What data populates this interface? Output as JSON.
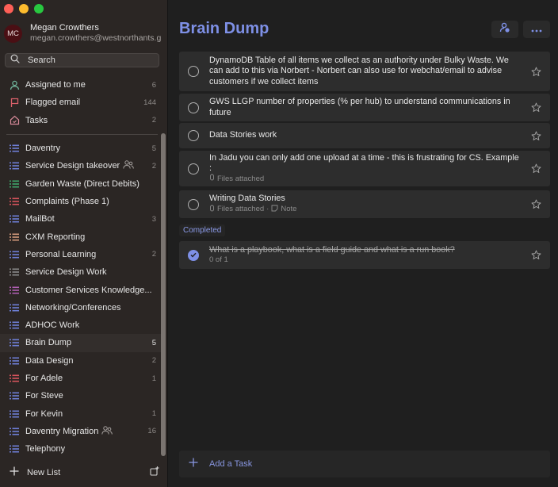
{
  "window": {
    "controls": [
      "close",
      "minimize",
      "maximize"
    ]
  },
  "account": {
    "initials": "MC",
    "name": "Megan Crowthers",
    "email": "megan.crowthers@westnorthants.gov.uk"
  },
  "search": {
    "label": "Search"
  },
  "smart_lists": [
    {
      "label": "Assigned to me",
      "count": "6",
      "icon": "person-icon",
      "color": "#6fb39a"
    },
    {
      "label": "Flagged email",
      "count": "144",
      "icon": "flag-icon",
      "color": "#d9606a"
    },
    {
      "label": "Tasks",
      "count": "2",
      "icon": "home-icon",
      "color": "#d98b9a"
    }
  ],
  "lists": [
    {
      "label": "Daventry",
      "count": "5",
      "color": "#6e7fd6",
      "shared": false
    },
    {
      "label": "Service Design takeover",
      "count": "2",
      "color": "#6e7fd6",
      "shared": true
    },
    {
      "label": "Garden Waste (Direct Debits)",
      "count": "",
      "color": "#3fa66b",
      "shared": false
    },
    {
      "label": "Complaints (Phase 1)",
      "count": "",
      "color": "#d6545c",
      "shared": false
    },
    {
      "label": "MailBot",
      "count": "3",
      "color": "#6e7fd6",
      "shared": false
    },
    {
      "label": "CXM Reporting",
      "count": "",
      "color": "#d39a7c",
      "shared": false
    },
    {
      "label": "Personal Learning",
      "count": "2",
      "color": "#6e7fd6",
      "shared": false
    },
    {
      "label": "Service Design Work",
      "count": "",
      "color": "#8a8a8a",
      "shared": false
    },
    {
      "label": "Customer Services Knowledge...",
      "count": "",
      "color": "#b05fb3",
      "shared": false
    },
    {
      "label": "Networking/Conferences",
      "count": "",
      "color": "#6e7fd6",
      "shared": false
    },
    {
      "label": "ADHOC Work",
      "count": "",
      "color": "#6e7fd6",
      "shared": false
    },
    {
      "label": "Brain Dump",
      "count": "5",
      "color": "#6e7fd6",
      "shared": false,
      "active": true
    },
    {
      "label": "Data Design",
      "count": "2",
      "color": "#6e7fd6",
      "shared": false
    },
    {
      "label": "For Adele",
      "count": "1",
      "color": "#d6545c",
      "shared": false
    },
    {
      "label": "For Steve",
      "count": "",
      "color": "#6e7fd6",
      "shared": false
    },
    {
      "label": "For Kevin",
      "count": "1",
      "color": "#6e7fd6",
      "shared": false
    },
    {
      "label": "Daventry Migration",
      "count": "16",
      "color": "#6e7fd6",
      "shared": true
    },
    {
      "label": "Telephony",
      "count": "",
      "color": "#6e7fd6",
      "shared": false
    }
  ],
  "new_list": {
    "label": "New List"
  },
  "main": {
    "title": "Brain Dump",
    "accent": "#7e90e6",
    "tasks": [
      {
        "title": "DynamoDB Table of all items we collect as an authority under Bulky Waste. We can add to this via Norbert - Norbert can also use for webchat/email to advise customers if we collect items",
        "meta": []
      },
      {
        "title": "GWS LLGP number of properties (% per hub) to understand communications in future",
        "meta": []
      },
      {
        "title": "Data Stories work",
        "meta": []
      },
      {
        "title": "In Jadu you can only add one upload at a time - this is frustrating for CS. Example :",
        "meta": [
          "Files attached"
        ]
      },
      {
        "title": "Writing Data Stories",
        "meta": [
          "Files attached",
          "Note"
        ]
      }
    ],
    "completed_label": "Completed",
    "completed_tasks": [
      {
        "title": "What is a playbook, what is a field guide and what is a run book?",
        "steps": "0 of 1"
      }
    ],
    "add_task_label": "Add a Task"
  }
}
